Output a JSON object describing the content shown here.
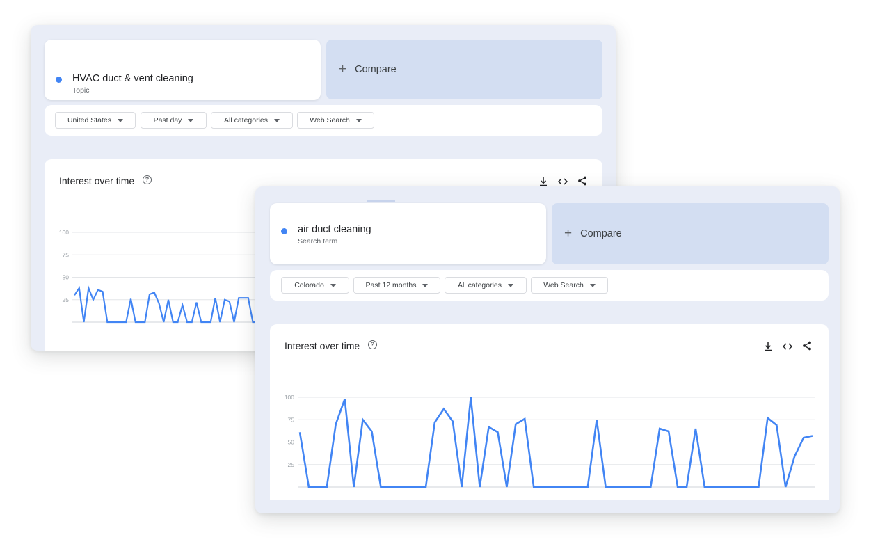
{
  "panels": [
    {
      "term": {
        "name": "HVAC duct & vent cleaning",
        "type": "Topic"
      },
      "compare_label": "Compare",
      "filters": [
        {
          "label": "United States"
        },
        {
          "label": "Past day"
        },
        {
          "label": "All categories"
        },
        {
          "label": "Web Search"
        }
      ],
      "chart": {
        "title": "Interest over time",
        "icons": [
          "download-icon",
          "embed-code-icon",
          "share-icon"
        ]
      }
    },
    {
      "term": {
        "name": "air duct cleaning",
        "type": "Search term"
      },
      "compare_label": "Compare",
      "filters": [
        {
          "label": "Colorado"
        },
        {
          "label": "Past 12 months"
        },
        {
          "label": "All categories"
        },
        {
          "label": "Web Search"
        }
      ],
      "chart": {
        "title": "Interest over time",
        "icons": [
          "download-icon",
          "embed-code-icon",
          "share-icon"
        ]
      }
    }
  ],
  "colors": {
    "series": "#4285f4",
    "compare_bg": "#d3def2",
    "card_bg": "#e9edf7"
  },
  "chart_data": [
    {
      "type": "line",
      "title": "Interest over time",
      "yticks": [
        25,
        50,
        75,
        100
      ],
      "ylim": [
        0,
        100
      ],
      "grid": true,
      "series": [
        {
          "values": [
            30,
            38,
            0,
            38,
            25,
            36,
            34,
            0,
            0,
            0,
            0,
            0,
            26,
            0,
            0,
            0,
            31,
            33,
            21,
            0,
            25,
            0,
            0,
            19,
            0,
            0,
            22,
            0,
            0,
            0,
            27,
            0,
            25,
            23,
            0,
            27,
            27,
            27,
            0,
            0,
            0,
            0,
            0,
            25,
            0,
            0,
            30,
            28,
            0,
            0,
            26,
            0,
            0,
            0,
            37,
            0,
            0,
            0,
            0,
            0,
            0,
            0,
            0,
            0,
            0,
            0,
            0,
            0,
            0,
            0,
            0,
            0,
            0,
            0,
            0,
            0,
            0,
            0,
            0,
            0,
            0,
            0,
            0,
            0,
            0,
            0,
            0,
            0,
            0,
            0,
            0,
            0,
            0,
            0,
            0,
            0,
            0,
            0,
            0,
            0,
            0,
            0,
            0,
            0,
            0,
            0,
            0,
            0,
            0,
            0,
            0,
            0,
            30
          ]
        }
      ]
    },
    {
      "type": "line",
      "title": "Interest over time",
      "yticks": [
        25,
        50,
        75,
        100
      ],
      "ylim": [
        0,
        100
      ],
      "grid": true,
      "series": [
        {
          "values": [
            61,
            0,
            0,
            0,
            70,
            98,
            0,
            75,
            62,
            0,
            0,
            0,
            0,
            0,
            0,
            72,
            87,
            73,
            0,
            100,
            0,
            67,
            61,
            0,
            70,
            76,
            0,
            0,
            0,
            0,
            0,
            0,
            0,
            75,
            0,
            0,
            0,
            0,
            0,
            0,
            65,
            62,
            0,
            0,
            65,
            0,
            0,
            0,
            0,
            0,
            0,
            0,
            77,
            69,
            0,
            34,
            55,
            57
          ]
        }
      ]
    }
  ]
}
